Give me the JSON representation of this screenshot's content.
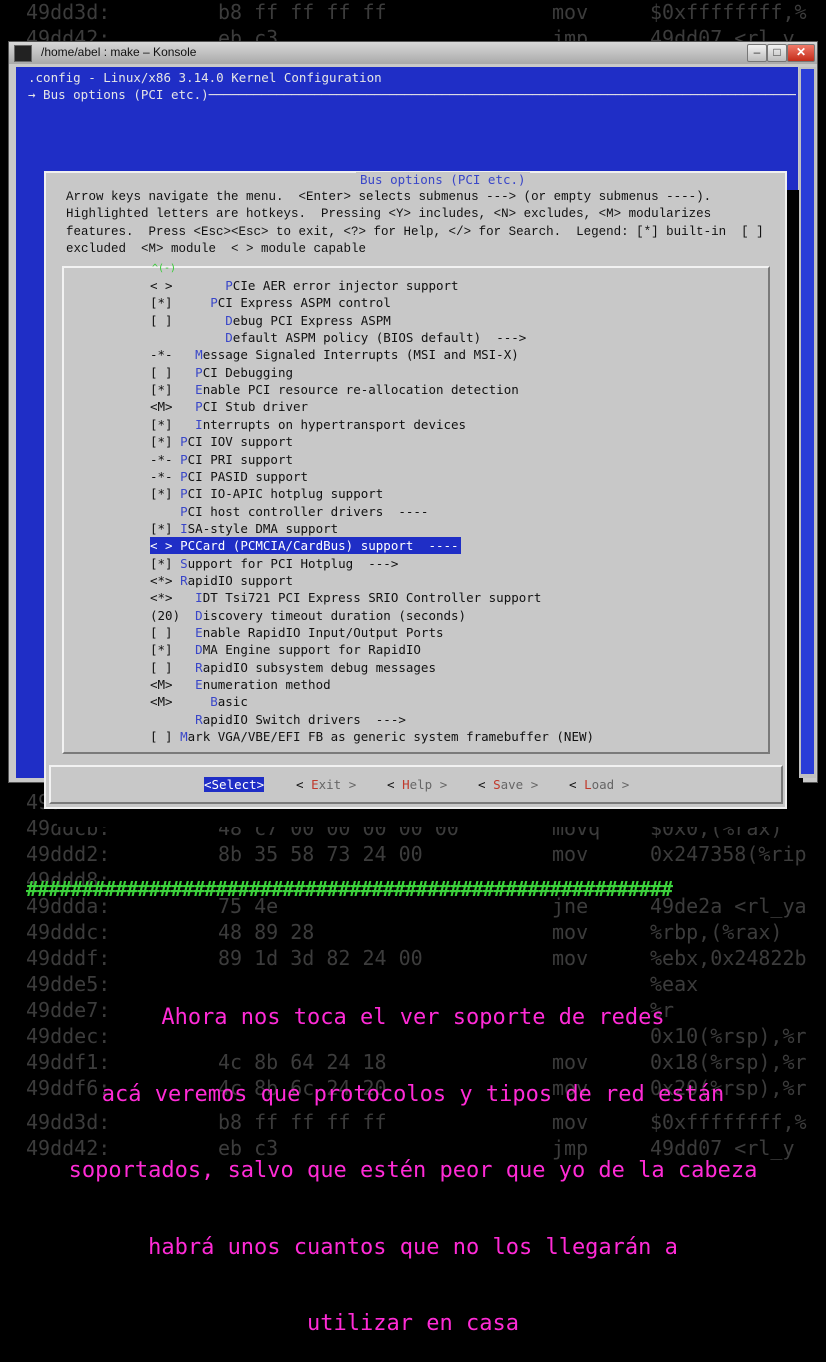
{
  "background_dump": [
    {
      "addr": "49dd3d:",
      "bytes": "b8 ff ff ff ff",
      "mnem": "mov",
      "ops": "$0xffffffff,%"
    },
    {
      "addr": "49dd42:",
      "bytes": "eb c3",
      "mnem": "jmp",
      "ops": "49dd07 <rl_y"
    },
    {
      "addr": "49ddc8:",
      "bytes": "4c 01 e0",
      "mnem": "add",
      "ops": "%r12,%rax"
    },
    {
      "addr": "49ddcb:",
      "bytes": "48 c7 00 00 00 00 00",
      "mnem": "movq",
      "ops": "$0x0,(%rax)"
    },
    {
      "addr": "49ddd2:",
      "bytes": "8b 35 58 73 24 00",
      "mnem": "mov",
      "ops": "0x247358(%rip"
    },
    {
      "addr": "49ddd8:",
      "bytes": "",
      "mnem": "",
      "ops": ""
    },
    {
      "addr": "49ddda:",
      "bytes": "75 4e",
      "mnem": "jne",
      "ops": "49de2a <rl_ya"
    },
    {
      "addr": "49dddc:",
      "bytes": "48 89 28",
      "mnem": "mov",
      "ops": "%rbp,(%rax)"
    },
    {
      "addr": "49dddf:",
      "bytes": "89 1d 3d 82 24 00",
      "mnem": "mov",
      "ops": "%ebx,0x24822b"
    },
    {
      "addr": "49dde5:",
      "bytes": "",
      "mnem": "",
      "ops": "%eax"
    },
    {
      "addr": "49dde7:",
      "bytes": "",
      "mnem": "",
      "ops": "%r"
    },
    {
      "addr": "49ddec:",
      "bytes": "",
      "mnem": "",
      "ops": "0x10(%rsp),%r"
    },
    {
      "addr": "49ddf1:",
      "bytes": "4c 8b 64 24 18",
      "mnem": "mov",
      "ops": "0x18(%rsp),%r"
    },
    {
      "addr": "49ddf6:",
      "bytes": "4c 8b 6c 24 20",
      "mnem": "mov",
      "ops": "0x20(%rsp),%r"
    },
    {
      "addr": "49dd3d:",
      "bytes": "b8 ff ff ff ff",
      "mnem": "mov",
      "ops": "$0xffffffff,%"
    },
    {
      "addr": "49dd42:",
      "bytes": "eb c3",
      "mnem": "jmp",
      "ops": "49dd07 <rl_y"
    }
  ],
  "window": {
    "title": "/home/abel : make – Konsole",
    "minimize": "–",
    "maximize": "□",
    "close": "✕"
  },
  "terminal": {
    "config_line": ".config - Linux/x86 3.14.0 Kernel Configuration",
    "breadcrumb": "→ Bus options (PCI etc.)──────────────────────────────────────────────────────────────────────────────────────"
  },
  "dialog": {
    "title": "Bus options (PCI etc.)",
    "help_lines": [
      "Arrow keys navigate the menu.  <Enter> selects submenus ---> (or empty submenus ----).",
      "Highlighted letters are hotkeys.  Pressing <Y> includes, <N> excludes, <M> modularizes",
      "features.  Press <Esc><Esc> to exit, <?> for Help, </> for Search.  Legend: [*] built-in  [ ]",
      "excluded  <M> module  < > module capable"
    ],
    "scroll_indicator": "^(-)",
    "menu_items": [
      {
        "pre": "< >       ",
        "hk": "P",
        "rest": "CIe AER error injector support"
      },
      {
        "pre": "[*]     ",
        "hk": "P",
        "rest": "CI Express ASPM control"
      },
      {
        "pre": "[ ]       ",
        "hk": "D",
        "rest": "ebug PCI Express ASPM"
      },
      {
        "pre": "          ",
        "hk": "D",
        "rest": "efault ASPM policy (BIOS default)  --->"
      },
      {
        "pre": "-*-   ",
        "hk": "M",
        "rest": "essage Signaled Interrupts (MSI and MSI-X)"
      },
      {
        "pre": "[ ]   ",
        "hk": "P",
        "rest": "CI Debugging"
      },
      {
        "pre": "[*]   ",
        "hk": "E",
        "rest": "nable PCI resource re-allocation detection"
      },
      {
        "pre": "<M>   ",
        "hk": "P",
        "rest": "CI Stub driver"
      },
      {
        "pre": "[*]   ",
        "hk": "I",
        "rest": "nterrupts on hypertransport devices"
      },
      {
        "pre": "[*] ",
        "hk": "P",
        "rest": "CI IOV support"
      },
      {
        "pre": "-*- ",
        "hk": "P",
        "rest": "CI PRI support"
      },
      {
        "pre": "-*- ",
        "hk": "P",
        "rest": "CI PASID support"
      },
      {
        "pre": "[*] ",
        "hk": "P",
        "rest": "CI IO-APIC hotplug support"
      },
      {
        "pre": "    ",
        "hk": "P",
        "rest": "CI host controller drivers  ----"
      },
      {
        "pre": "[*] ",
        "hk": "I",
        "rest": "SA-style DMA support"
      },
      {
        "pre": "< > ",
        "hk": "P",
        "rest": "CCard (PCMCIA/CardBus) support  ----",
        "selected": true
      },
      {
        "pre": "[*] ",
        "hk": "S",
        "rest": "upport for PCI Hotplug  --->"
      },
      {
        "pre": "<*> ",
        "hk": "R",
        "rest": "apidIO support"
      },
      {
        "pre": "<*>   ",
        "hk": "I",
        "rest": "DT Tsi721 PCI Express SRIO Controller support"
      },
      {
        "pre": "(20)  ",
        "hk": "D",
        "rest": "iscovery timeout duration (seconds)"
      },
      {
        "pre": "[ ]   ",
        "hk": "E",
        "rest": "nable RapidIO Input/Output Ports"
      },
      {
        "pre": "[*]   ",
        "hk": "D",
        "rest": "MA Engine support for RapidIO"
      },
      {
        "pre": "[ ]   ",
        "hk": "R",
        "rest": "apidIO subsystem debug messages"
      },
      {
        "pre": "<M>   ",
        "hk": "E",
        "rest": "numeration method"
      },
      {
        "pre": "<M>     ",
        "hk": "B",
        "rest": "asic"
      },
      {
        "pre": "      ",
        "hk": "R",
        "rest": "apidIO Switch drivers  --->"
      },
      {
        "pre": "[ ] ",
        "hk": "M",
        "rest": "ark VGA/VBE/EFI FB as generic system framebuffer (NEW)"
      }
    ],
    "buttons": {
      "select": "<Select>",
      "exit": {
        "l": "< ",
        "hk": "E",
        "r": "xit >"
      },
      "help": {
        "l": "< ",
        "hk": "H",
        "r": "elp >"
      },
      "save": {
        "l": "< ",
        "hk": "S",
        "r": "ave >"
      },
      "load": {
        "l": "< ",
        "hk": "L",
        "r": "oad >"
      }
    }
  },
  "overlay": {
    "hashes": "##########################################################",
    "caption": [
      "Ahora nos toca el ver soporte de redes",
      "acá veremos que protocolos y tipos de red están",
      "soportados, salvo que estén peor que yo de la cabeza",
      "habrá unos cuantos que no los llegarán a",
      "utilizar en casa"
    ]
  }
}
